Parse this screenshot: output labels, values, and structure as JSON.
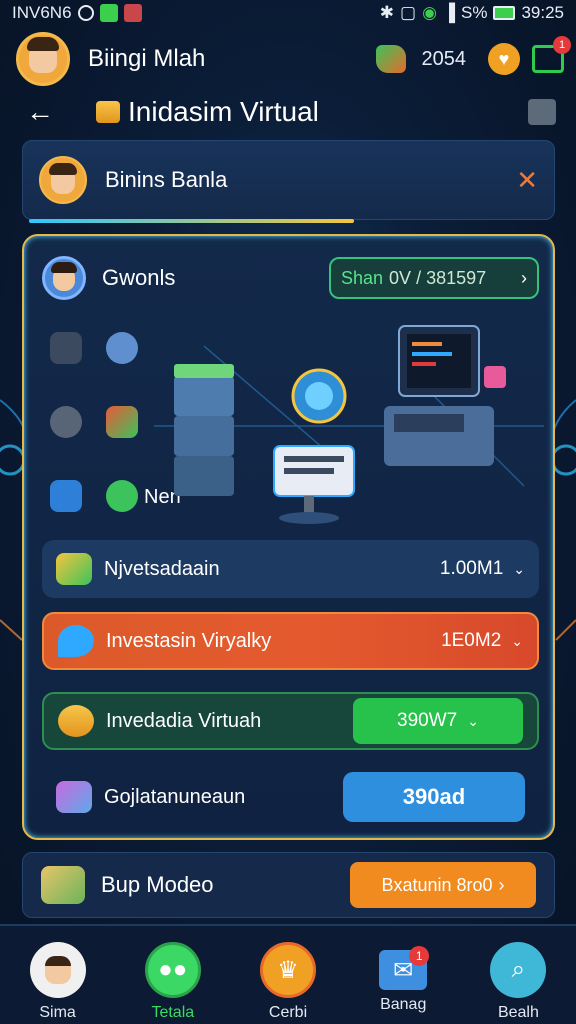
{
  "status_bar": {
    "carrier": "INV6N6",
    "signal_text": "S%",
    "time": "39:25"
  },
  "header": {
    "username": "Biingi Mlah",
    "coins": "2054"
  },
  "title_row": {
    "title": "Inidasim Virtual"
  },
  "profile_card": {
    "name": "Binins Banla"
  },
  "panel": {
    "title": "Gwonls",
    "share_label": "Shan",
    "share_value": "0V / 381597",
    "nen_label": "Nen"
  },
  "rows": [
    {
      "label": "Njvetsadaain",
      "value": "1.00M1"
    },
    {
      "label": "Investasin Viryalky",
      "value": "1E0M2"
    },
    {
      "label": "Invedadia Virtuah",
      "value": "390W7"
    },
    {
      "label": "Gojlatanuneaun",
      "value": "390ad"
    }
  ],
  "bottom_card": {
    "label": "Bup Modeo",
    "button": "Bxatunin 8ro0"
  },
  "nav": [
    {
      "label": "Sima",
      "icon": "avatar-icon"
    },
    {
      "label": "Tetala",
      "icon": "chat-icon"
    },
    {
      "label": "Cerbi",
      "icon": "trophy-icon"
    },
    {
      "label": "Banag",
      "icon": "mail-icon",
      "badge": "1"
    },
    {
      "label": "Bealh",
      "icon": "search-icon"
    }
  ],
  "colors": {
    "accent_gold": "#e5b949",
    "green": "#27c24b",
    "orange": "#f18a1f",
    "blue": "#2e8fdf",
    "red_row": "#dc5a2a"
  }
}
